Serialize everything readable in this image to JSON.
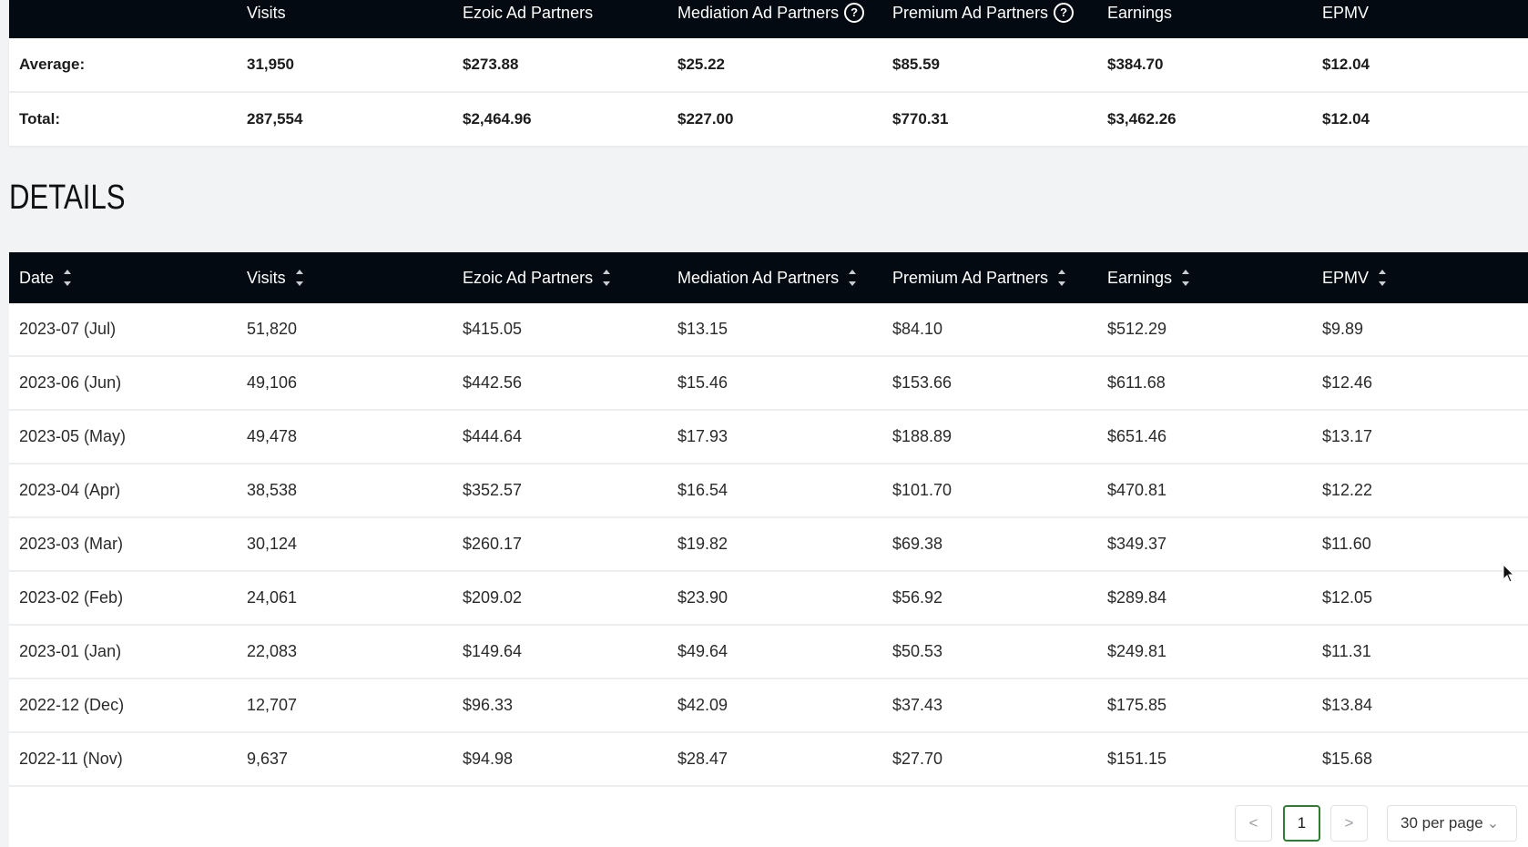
{
  "summary": {
    "headers": [
      "",
      "Visits",
      "Ezoic Ad Partners",
      "Mediation Ad Partners",
      "Premium Ad Partners",
      "Earnings",
      "EPMV"
    ],
    "rows": [
      [
        "Average:",
        "31,950",
        "$273.88",
        "$25.22",
        "$85.59",
        "$384.70",
        "$12.04"
      ],
      [
        "Total:",
        "287,554",
        "$2,464.96",
        "$227.00",
        "$770.31",
        "$3,462.26",
        "$12.04"
      ]
    ]
  },
  "details": {
    "title": "DETAILS",
    "headers": [
      "Date",
      "Visits",
      "Ezoic Ad Partners",
      "Mediation Ad Partners",
      "Premium Ad Partners",
      "Earnings",
      "EPMV"
    ],
    "rows": [
      [
        "2023-07 (Jul)",
        "51,820",
        "$415.05",
        "$13.15",
        "$84.10",
        "$512.29",
        "$9.89"
      ],
      [
        "2023-06 (Jun)",
        "49,106",
        "$442.56",
        "$15.46",
        "$153.66",
        "$611.68",
        "$12.46"
      ],
      [
        "2023-05 (May)",
        "49,478",
        "$444.64",
        "$17.93",
        "$188.89",
        "$651.46",
        "$13.17"
      ],
      [
        "2023-04 (Apr)",
        "38,538",
        "$352.57",
        "$16.54",
        "$101.70",
        "$470.81",
        "$12.22"
      ],
      [
        "2023-03 (Mar)",
        "30,124",
        "$260.17",
        "$19.82",
        "$69.38",
        "$349.37",
        "$11.60"
      ],
      [
        "2023-02 (Feb)",
        "24,061",
        "$209.02",
        "$23.90",
        "$56.92",
        "$289.84",
        "$12.05"
      ],
      [
        "2023-01 (Jan)",
        "22,083",
        "$149.64",
        "$49.64",
        "$50.53",
        "$249.81",
        "$11.31"
      ],
      [
        "2022-12 (Dec)",
        "12,707",
        "$96.33",
        "$42.09",
        "$37.43",
        "$175.85",
        "$13.84"
      ],
      [
        "2022-11 (Nov)",
        "9,637",
        "$94.98",
        "$28.47",
        "$27.70",
        "$151.15",
        "$15.68"
      ]
    ]
  },
  "pagination": {
    "prev": "<",
    "current_page": "1",
    "next": ">",
    "per_page": "30 per page"
  },
  "icons": {
    "help": "help-circle-icon",
    "sort": "sort-icon",
    "chevron": "chevron-down-icon"
  },
  "colors": {
    "header_bg": "#040a12",
    "active_page_border": "#2e7d32",
    "page_bg": "#f2f3f5"
  }
}
